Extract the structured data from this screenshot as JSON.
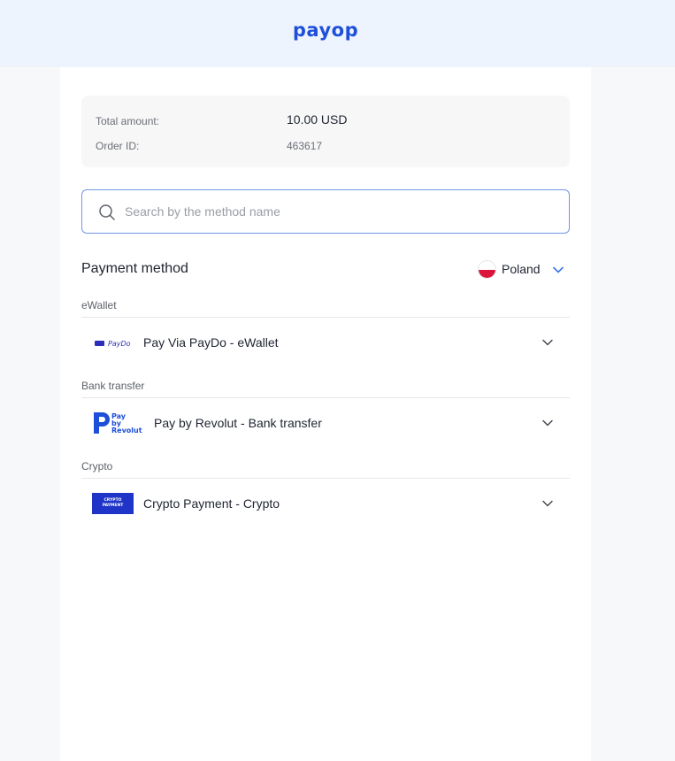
{
  "header": {
    "logo_text": "payop"
  },
  "summary": {
    "total_label": "Total amount:",
    "total_value": "10.00 USD",
    "order_label": "Order ID:",
    "order_value": "463617"
  },
  "search": {
    "placeholder": "Search by the method name",
    "value": ""
  },
  "payment": {
    "title": "Payment method",
    "country": "Poland",
    "sections": [
      {
        "label": "eWallet",
        "method": "Pay Via PayDo - eWallet",
        "icon": "paydo-logo"
      },
      {
        "label": "Bank transfer",
        "method": "Pay by Revolut - Bank transfer",
        "icon": "revolut-logo"
      },
      {
        "label": "Crypto",
        "method": "Crypto Payment - Crypto",
        "icon": "crypto-payment-logo"
      }
    ]
  },
  "logos": {
    "paydo": "PayDo",
    "revolut_line1": "Pay",
    "revolut_line2": "by",
    "revolut_line3": "Revolut",
    "crypto_line1": "CRYPTO",
    "crypto_line2": "PAYMENT"
  },
  "colors": {
    "brand": "#1d4fd8",
    "header_bg": "#eef4fe",
    "search_border": "#6f95e6",
    "chevron_accent": "#3b74e8",
    "crypto_bg": "#1f35c7"
  }
}
